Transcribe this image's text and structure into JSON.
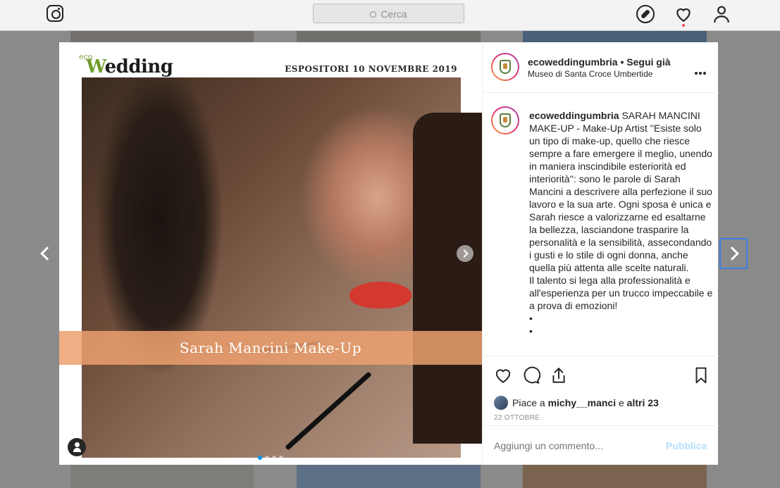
{
  "topnav": {
    "search_placeholder": "Cerca"
  },
  "media": {
    "logo_small": "eco",
    "logo_initial": "W",
    "logo_rest": "edding",
    "expo_label": "ESPOSITORI 10 NOVEMBRE 2019",
    "banner_label": "Sarah Mancini Make-Up",
    "carousel": {
      "total": 4,
      "active": 1
    }
  },
  "post": {
    "username": "ecoweddingumbria",
    "separator": " • ",
    "follow_status": "Segui già",
    "location": "Museo di Santa Croce Umbertide",
    "caption_user": "ecoweddingumbria",
    "caption_text": "SARAH MANCINI MAKE-UP - Make-Up Artist ''Esiste solo un tipo di make-up, quello che riesce sempre a fare emergere il meglio, unendo in maniera inscindibile esteriorità ed interiorità'': sono le parole di Sarah Mancini a descrivere alla perfezione il suo lavoro e la sua arte. Ogni sposa è unica e Sarah riesce a valorizzarne ed esaltarne la bellezza, lasciandone trasparire la personalità e la sensibilità, assecondando i gusti e lo stile di ogni donna, anche quella più attenta alle scelte naturali.",
    "caption_text2": "Il talento si lega alla professionalità e all'esperienza per un trucco impeccabile e a prova di emozioni!",
    "bullet1": "•",
    "bullet2": "•",
    "likes_prefix": "Piace a ",
    "likes_user": "michy__manci",
    "likes_mid": " e ",
    "likes_others": "altri 23",
    "date": "22 OTTOBRE",
    "comment_placeholder": "Aggiungi un commento...",
    "publish_label": "Pubblica"
  },
  "colors": {
    "accent": "#0095f6",
    "publish_disabled": "#b2dffc",
    "notification": "#ed4956",
    "banner": "#eca06e",
    "focus_ring": "#3d7fe0"
  },
  "icons": [
    "instagram-logo-icon",
    "search-icon",
    "compass-icon",
    "heart-icon",
    "profile-icon",
    "chevron-left-icon",
    "chevron-right-icon",
    "more-icon",
    "like-icon",
    "comment-icon",
    "share-icon",
    "bookmark-icon",
    "tag-people-icon"
  ]
}
